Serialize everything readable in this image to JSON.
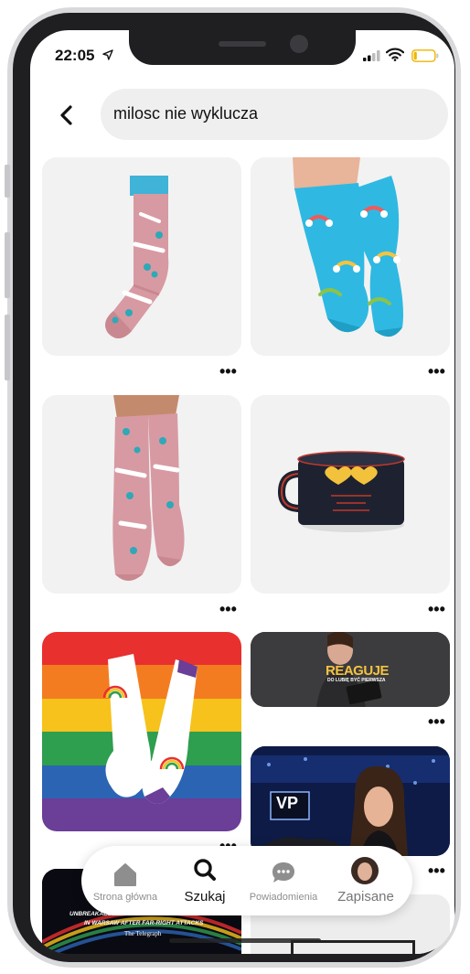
{
  "status_bar": {
    "time": "22:05"
  },
  "search": {
    "query": "milosc nie wyklucza"
  },
  "pins": {
    "more_label": "•••",
    "news_headline_1": "UNBREAKABLE LGBT RAINBOW INSTALLATION UNVEILED",
    "news_headline_2": "IN WARSAW AFTER FAR-RIGHT ATTACKS",
    "news_source": "The Telegraph",
    "video_title": "REAGUJE",
    "video_subtitle": "DO LUBIĘ BYĆ PIERWSZA",
    "tv_logo": "VP"
  },
  "nav": {
    "home": "Strona główna",
    "search": "Szukaj",
    "notifications": "Powiadomienia",
    "saved": "Zapisane"
  },
  "colors": {
    "sock_pink": "#d79aa2",
    "sock_teal": "#2fb9e2",
    "mug": "#1e2230",
    "accent_text": "#111111"
  }
}
